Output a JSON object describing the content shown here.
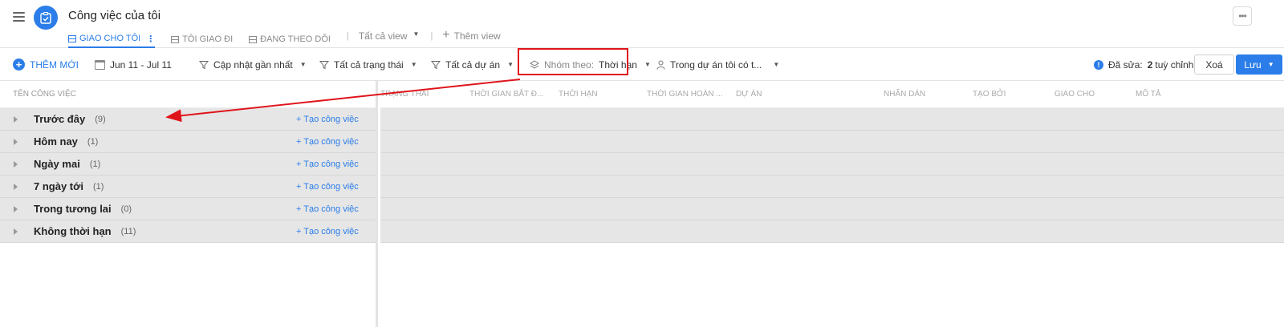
{
  "header": {
    "title": "Công việc của tôi",
    "tabs": [
      {
        "label": "GIAO CHO TÔI",
        "active": true
      },
      {
        "label": "TÔI GIAO ĐI",
        "active": false
      },
      {
        "label": "ĐANG THEO DÕI",
        "active": false
      }
    ],
    "all_views": "Tất cả view",
    "add_view": "Thêm view"
  },
  "toolbar": {
    "add_new": "THÊM MỚI",
    "date_range": "Jun 11 - Jul 11",
    "sort": "Cập nhật gần nhất",
    "status_filter": "Tất cả trạng thái",
    "project_filter": "Tất cả dự án",
    "group_label": "Nhóm theo:",
    "group_value": "Thời hạn",
    "scope_filter": "Trong dự án tôi có t...",
    "edited_prefix": "Đã sửa:",
    "edited_count": "2",
    "edited_suffix": "tuỳ chỉnh",
    "delete": "Xoá",
    "save": "Lưu"
  },
  "table": {
    "name_column": "TÊN CÔNG VIỆC",
    "columns": [
      "TRẠNG THÁI",
      "THỜI GIAN BẮT Đ...",
      "THỜI HẠN",
      "THỜI GIAN HOÀN ...",
      "DỰ ÁN",
      "NHÃN DÁN",
      "TẠO BỞI",
      "GIAO CHO",
      "MÔ TẢ"
    ],
    "create_label": "+ Tạo công việc",
    "groups": [
      {
        "label": "Trước đây",
        "count": "(9)"
      },
      {
        "label": "Hôm nay",
        "count": "(1)"
      },
      {
        "label": "Ngày mai",
        "count": "(1)"
      },
      {
        "label": "7 ngày tới",
        "count": "(1)"
      },
      {
        "label": "Trong tương lai",
        "count": "(0)"
      },
      {
        "label": "Không thời hạn",
        "count": "(11)"
      }
    ]
  },
  "colors": {
    "accent": "#2b7de9",
    "annotation": "#e0141b",
    "group_bg": "#e6e6e6"
  }
}
